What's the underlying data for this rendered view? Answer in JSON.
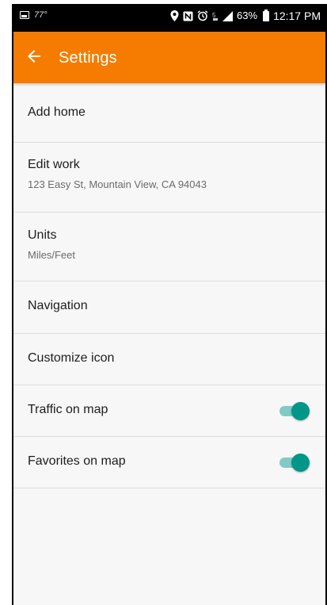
{
  "status_bar": {
    "temperature": "77°",
    "battery": "63%",
    "time": "12:17 PM",
    "icons": [
      "gallery-icon",
      "location-icon",
      "nfc-icon",
      "alarm-icon",
      "sim-icon",
      "signal-icon",
      "battery-icon"
    ]
  },
  "app_bar": {
    "title": "Settings",
    "back_icon": "arrow-back-icon",
    "color": "#f57c00"
  },
  "settings": {
    "items": [
      {
        "title": "Add home"
      },
      {
        "title": "Edit work",
        "subtitle": "123 Easy St, Mountain View, CA 94043"
      },
      {
        "title": "Units",
        "subtitle": "Miles/Feet"
      },
      {
        "title": "Navigation"
      },
      {
        "title": "Customize icon"
      },
      {
        "title": "Traffic on map",
        "toggle": true
      },
      {
        "title": "Favorites on map",
        "toggle": true
      }
    ]
  },
  "colors": {
    "accent": "#009688",
    "track": "#80cbc4",
    "background": "#f7f7f7"
  }
}
